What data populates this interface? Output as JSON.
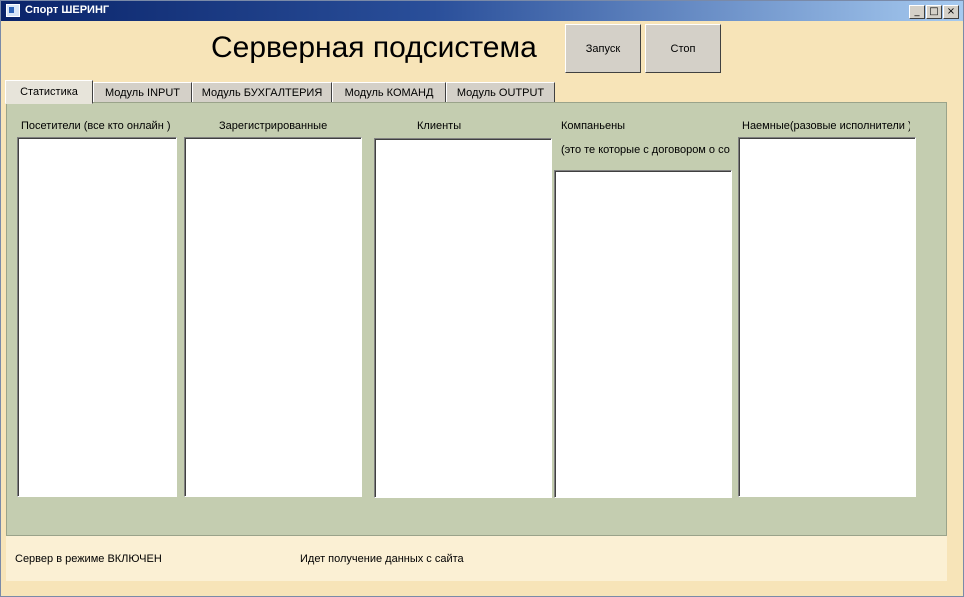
{
  "window": {
    "title": "Спорт ШЕРИНГ",
    "controls": {
      "minimize": "_",
      "maximize": "□",
      "close": "×"
    }
  },
  "header": {
    "title": "Серверная подсистема",
    "start_label": "Запуск",
    "stop_label": "Стоп"
  },
  "tabs": [
    {
      "label": "Статистика",
      "active": true
    },
    {
      "label": "Модуль INPUT",
      "active": false
    },
    {
      "label": "Модуль БУХГАЛТЕРИЯ",
      "active": false
    },
    {
      "label": "Модуль КОМАНД",
      "active": false
    },
    {
      "label": "Модуль OUTPUT",
      "active": false
    }
  ],
  "statistics": {
    "visitors_label": "Посетители (все кто онлайн )",
    "registered_label": "Зарегистрированные",
    "clients_label": "Клиенты",
    "companions_label": "Компаньены",
    "companions_note": "(это те которые с договором о со",
    "hired_label": "Наемные(разовые исполнители )"
  },
  "status": {
    "server_state": "Сервер в режиме ВКЛЮЧЕН",
    "activity": "Идет получение данных с сайта"
  },
  "colors": {
    "titlebar_start": "#0a246a",
    "titlebar_end": "#a6caf0",
    "window_bg": "#f7e4b8",
    "panel_bg": "#c4cdb0",
    "statusbar_bg": "#fbf0d4"
  }
}
